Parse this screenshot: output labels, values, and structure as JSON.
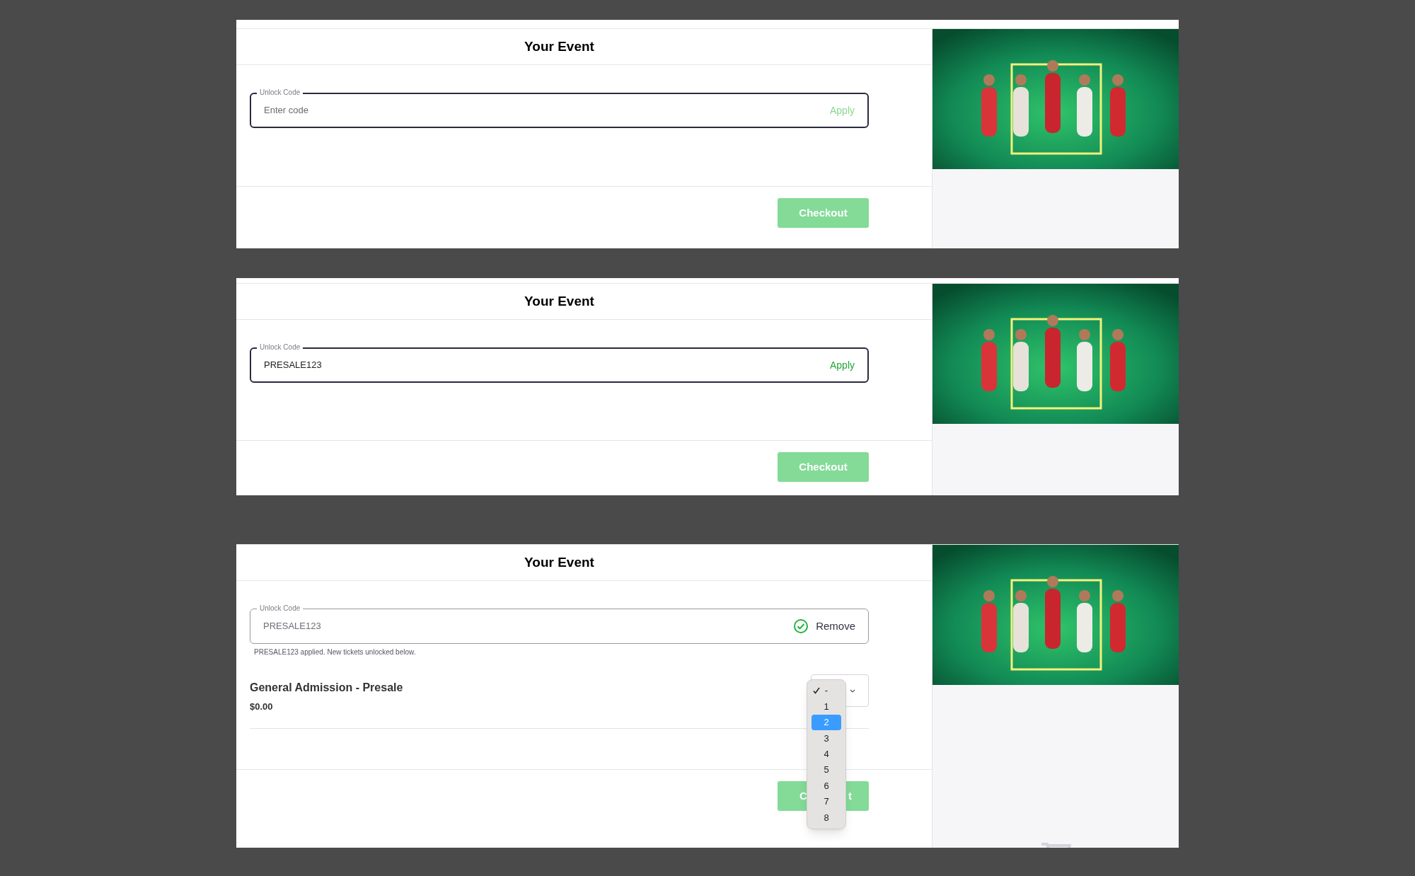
{
  "panels": [
    {
      "title": "Your Event",
      "unlock": {
        "label": "Unlock Code",
        "placeholder": "Enter code",
        "kind": "empty",
        "action": "Apply"
      },
      "checkout": "Checkout"
    },
    {
      "title": "Your Event",
      "unlock": {
        "label": "Unlock Code",
        "value": "PRESALE123",
        "kind": "typed",
        "action": "Apply"
      },
      "checkout": "Checkout"
    },
    {
      "title": "Your Event",
      "unlock": {
        "label": "Unlock Code",
        "value": "PRESALE123",
        "kind": "applied",
        "action": "Remove",
        "message": "PRESALE123 applied. New tickets unlocked below."
      },
      "tickets": [
        {
          "name": "General Admission - Presale",
          "price": "$0.00",
          "dropdown": [
            {
              "label": "-",
              "checked": true,
              "selected": false
            },
            {
              "label": "1",
              "checked": false,
              "selected": false
            },
            {
              "label": "2",
              "checked": false,
              "selected": true
            },
            {
              "label": "3",
              "checked": false,
              "selected": false
            },
            {
              "label": "4",
              "checked": false,
              "selected": false
            },
            {
              "label": "5",
              "checked": false,
              "selected": false
            },
            {
              "label": "6",
              "checked": false,
              "selected": false
            },
            {
              "label": "7",
              "checked": false,
              "selected": false
            },
            {
              "label": "8",
              "checked": false,
              "selected": false
            }
          ]
        }
      ],
      "checkout_parts": [
        "C",
        "t"
      ],
      "cart_icon": true
    }
  ]
}
